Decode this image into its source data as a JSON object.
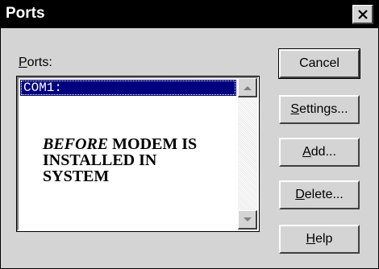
{
  "window": {
    "title": "Ports",
    "close_glyph": "✕"
  },
  "ports": {
    "label_prefix": "",
    "label_accel": "P",
    "label_rest": "orts:",
    "items": [
      "COM1:"
    ],
    "selected": "COM1:"
  },
  "note": {
    "em": "BEFORE",
    "rest": "MODEM IS INSTALLED IN SYSTEM"
  },
  "buttons": {
    "cancel": {
      "accel": "",
      "rest": "Cancel"
    },
    "settings": {
      "accel": "S",
      "rest": "ettings..."
    },
    "add": {
      "accel": "A",
      "rest": "dd..."
    },
    "delete": {
      "accel": "D",
      "rest": "elete..."
    },
    "help": {
      "accel": "H",
      "rest": "elp"
    }
  },
  "icons": {
    "close": "close-icon",
    "scroll_up": "scroll-up-arrow-icon",
    "scroll_down": "scroll-down-arrow-icon"
  }
}
